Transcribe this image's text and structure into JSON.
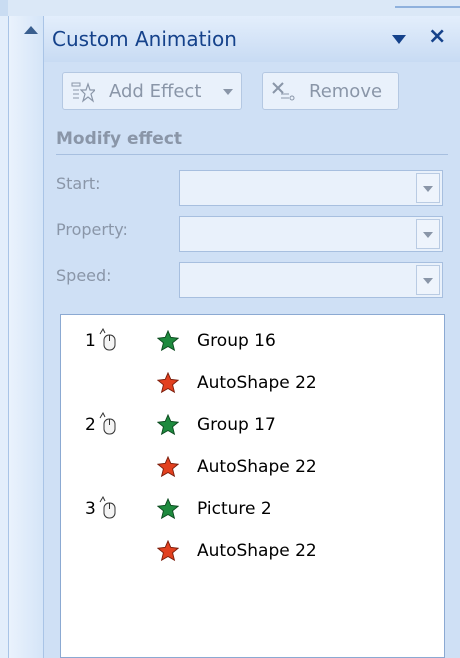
{
  "panel": {
    "title": "Custom Animation",
    "menu_icon": "chevron-down-icon",
    "close_label": "×"
  },
  "toolbar": {
    "add_effect_label": "Add Effect",
    "remove_label": "Remove"
  },
  "modify": {
    "section_title": "Modify effect",
    "start_label": "Start:",
    "property_label": "Property:",
    "speed_label": "Speed:",
    "start_value": "",
    "property_value": "",
    "speed_value": ""
  },
  "effects": [
    {
      "number": "1",
      "trigger": "on-click",
      "star_color": "#1e8a3e",
      "name": "Group 16"
    },
    {
      "number": "",
      "trigger": "",
      "star_color": "#e2401f",
      "name": "AutoShape 22"
    },
    {
      "number": "2",
      "trigger": "on-click",
      "star_color": "#1e8a3e",
      "name": "Group 17"
    },
    {
      "number": "",
      "trigger": "",
      "star_color": "#e2401f",
      "name": "AutoShape 22"
    },
    {
      "number": "3",
      "trigger": "on-click",
      "star_color": "#1e8a3e",
      "name": "Picture 2"
    },
    {
      "number": "",
      "trigger": "",
      "star_color": "#e2401f",
      "name": "AutoShape 22"
    }
  ],
  "colors": {
    "title_text": "#15428b",
    "disabled_text": "#8a96a8",
    "entrance_star": "#1e8a3e",
    "emphasis_star": "#e2401f"
  }
}
